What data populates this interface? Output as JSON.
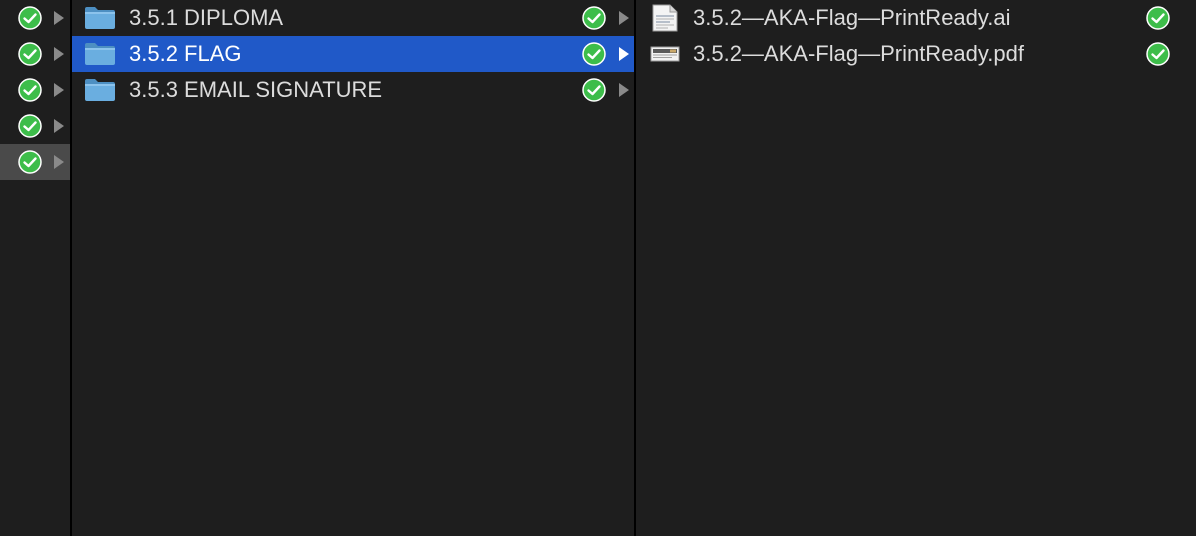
{
  "column1": {
    "rows": [
      {
        "status_icon": "synced-check-icon"
      },
      {
        "status_icon": "synced-check-icon"
      },
      {
        "status_icon": "synced-check-icon"
      },
      {
        "status_icon": "synced-check-icon"
      },
      {
        "status_icon": "synced-check-icon",
        "selected": true
      }
    ]
  },
  "column2": {
    "items": [
      {
        "label": "3.5.1 DIPLOMA",
        "icon": "folder-icon",
        "status_icon": "synced-check-icon"
      },
      {
        "label": "3.5.2 FLAG",
        "icon": "folder-icon",
        "status_icon": "synced-check-icon",
        "selected": true
      },
      {
        "label": "3.5.3 EMAIL SIGNATURE",
        "icon": "folder-icon",
        "status_icon": "synced-check-icon"
      }
    ]
  },
  "column3": {
    "items": [
      {
        "label": "3.5.2—AKA-Flag—PrintReady.ai",
        "icon": "ai-file-icon",
        "status_icon": "synced-check-icon"
      },
      {
        "label": "3.5.2—AKA-Flag—PrintReady.pdf",
        "icon": "pdf-file-icon",
        "status_icon": "synced-check-icon"
      }
    ]
  },
  "colors": {
    "background": "#1e1e1e",
    "selection": "#2059c8",
    "inactive_selection": "#4a4a4a",
    "check_green": "#3dbd4a",
    "folder_blue": "#5ea3d6",
    "text": "#dcdcdc"
  }
}
